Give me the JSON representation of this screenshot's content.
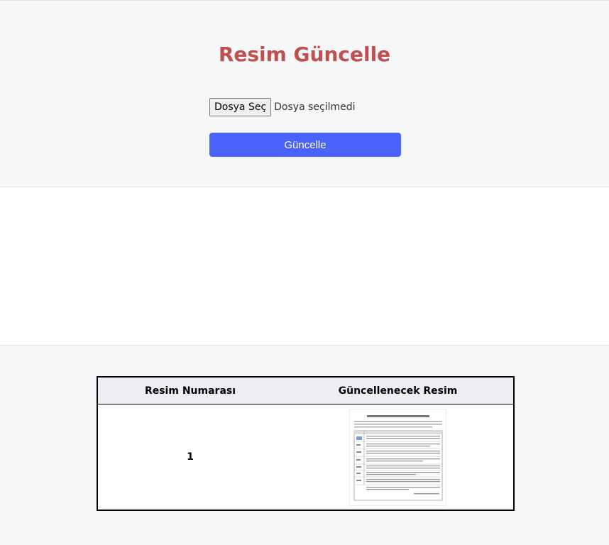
{
  "form": {
    "title": "Resim Güncelle",
    "file_button_label": "Dosya Seç",
    "file_status": "Dosya seçilmedi",
    "submit_label": "Güncelle"
  },
  "table": {
    "headers": [
      "Resim Numarası",
      "Güncellenecek Resim"
    ],
    "rows": [
      {
        "number": "1",
        "image": "document-thumbnail"
      }
    ]
  },
  "colors": {
    "title": "#c0504d",
    "button": "#4a63fd",
    "section_bg": "#f6f7f9"
  }
}
